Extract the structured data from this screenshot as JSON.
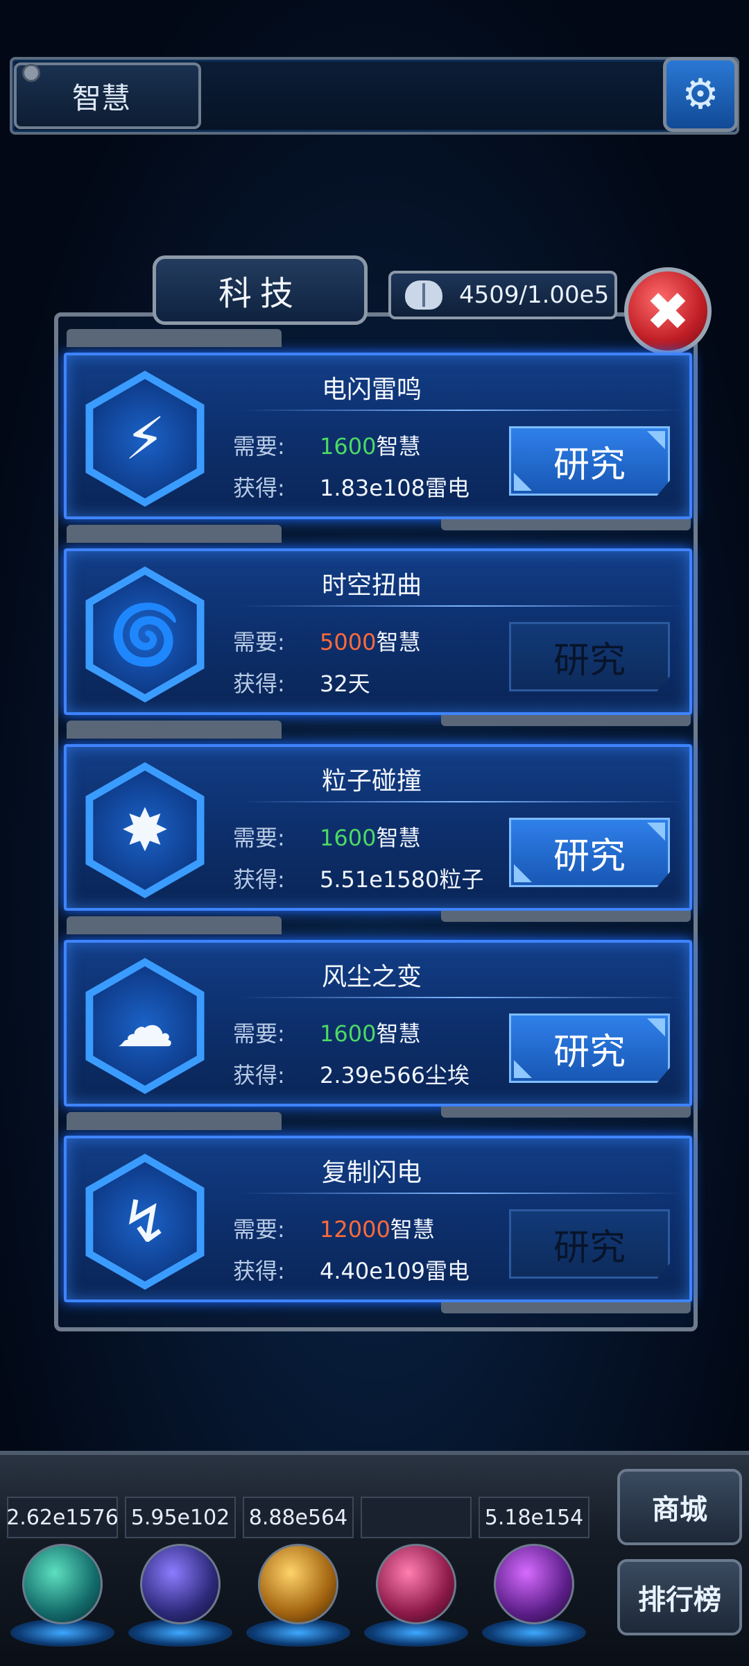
{
  "header": {
    "title": "智慧",
    "settings_icon": "gear-icon"
  },
  "panel": {
    "tab_title": "科技",
    "brain_count": "4509/1.00e5"
  },
  "labels": {
    "need": "需要:",
    "gain": "获得:",
    "research": "研究"
  },
  "items": [
    {
      "title": "电闪雷鸣",
      "need_value": "1600",
      "need_unit": "智慧",
      "need_status": "ok",
      "gain": "1.83e108雷电",
      "icon": "lightning-icon",
      "button_enabled": true
    },
    {
      "title": "时空扭曲",
      "need_value": "5000",
      "need_unit": "智慧",
      "need_status": "insufficient",
      "gain": "32天",
      "icon": "vortex-icon",
      "button_enabled": false
    },
    {
      "title": "粒子碰撞",
      "need_value": "1600",
      "need_unit": "智慧",
      "need_status": "ok",
      "gain": "5.51e1580粒子",
      "icon": "particle-explosion-icon",
      "button_enabled": true
    },
    {
      "title": "风尘之变",
      "need_value": "1600",
      "need_unit": "智慧",
      "need_status": "ok",
      "gain": "2.39e566尘埃",
      "icon": "dust-cloud-icon",
      "button_enabled": true
    },
    {
      "title": "复制闪电",
      "need_value": "12000",
      "need_unit": "智慧",
      "need_status": "insufficient",
      "gain": "4.40e109雷电",
      "icon": "copy-lightning-icon",
      "button_enabled": false
    }
  ],
  "resources": [
    {
      "value": "2.62e1576",
      "icon": "particle-orb-icon"
    },
    {
      "value": "5.95e102",
      "icon": "lightning-orb-icon"
    },
    {
      "value": "8.88e564",
      "icon": "dust-orb-icon"
    },
    {
      "value": "",
      "icon": "crown-orb-icon"
    },
    {
      "value": "5.18e154",
      "icon": "vortex-orb-icon"
    }
  ],
  "side_buttons": {
    "shop": "商城",
    "ranking": "排行榜"
  },
  "colors": {
    "ok": "#4cd964",
    "insufficient": "#ff6a3c",
    "card_border": "#3f84ff",
    "close": "#c01e26"
  }
}
